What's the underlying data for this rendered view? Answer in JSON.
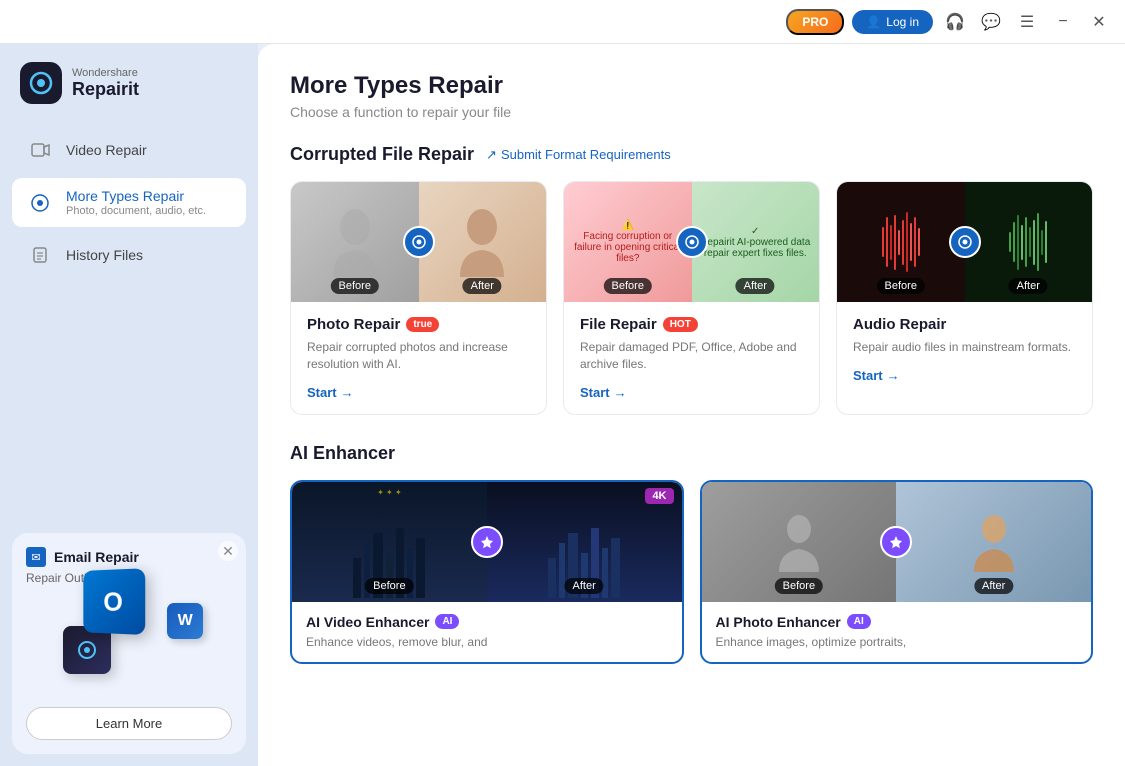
{
  "titlebar": {
    "pro_label": "PRO",
    "login_label": "Log in",
    "headset_icon": "🎧",
    "chat_icon": "💬",
    "menu_icon": "☰",
    "minimize_icon": "−",
    "close_icon": "✕"
  },
  "sidebar": {
    "brand": "Wondershare",
    "app_name": "Repairit",
    "nav_items": [
      {
        "id": "video-repair",
        "label": "Video Repair",
        "active": false
      },
      {
        "id": "more-types-repair",
        "label": "More Types Repair",
        "sub": "Photo, document, audio, etc.",
        "active": true
      },
      {
        "id": "history-files",
        "label": "History Files",
        "active": false
      }
    ]
  },
  "promo": {
    "title": "Email Repair",
    "subtitle": "Repair Outlook Files",
    "learn_more": "Learn More"
  },
  "main": {
    "title": "More Types Repair",
    "subtitle": "Choose a function to repair your file",
    "section1_title": "Corrupted File Repair",
    "section1_link": "Submit Format Requirements",
    "section2_title": "AI Enhancer",
    "cards": [
      {
        "id": "photo-repair",
        "title": "Photo Repair",
        "hot": true,
        "desc": "Repair corrupted photos and increase resolution with AI.",
        "start": "Start"
      },
      {
        "id": "file-repair",
        "title": "File Repair",
        "hot": true,
        "desc": "Repair damaged PDF, Office, Adobe and archive files.",
        "start": "Start"
      },
      {
        "id": "audio-repair",
        "title": "Audio Repair",
        "hot": false,
        "desc": "Repair audio files in mainstream formats.",
        "start": "Start"
      }
    ],
    "ai_cards": [
      {
        "id": "ai-video-enhancer",
        "title": "AI Video Enhancer",
        "ai_badge": "AI",
        "fourk": "4K",
        "desc": "Enhance videos, remove blur, and"
      },
      {
        "id": "ai-photo-enhancer",
        "title": "AI Photo Enhancer",
        "ai_badge": "AI",
        "desc": "Enhance images, optimize portraits,"
      }
    ]
  }
}
